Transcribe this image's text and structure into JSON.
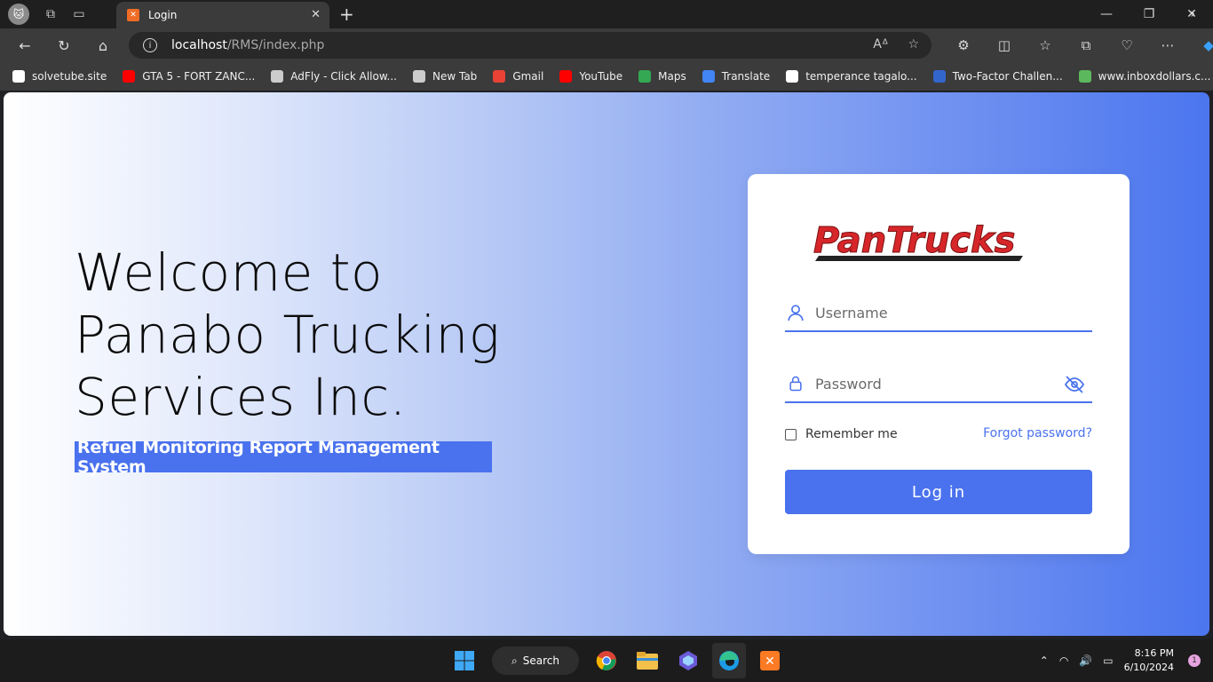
{
  "browser": {
    "tab_title": "Login",
    "url_host": "localhost",
    "url_path": "/RMS/index.php",
    "bookmarks": [
      {
        "label": "solvetube.site",
        "icon": "page-icon",
        "color": "#ffffff"
      },
      {
        "label": "GTA 5 - FORT ZANC...",
        "icon": "youtube-icon",
        "color": "#ff0000"
      },
      {
        "label": "AdFly - Click Allow...",
        "icon": "page-icon",
        "color": "#cccccc"
      },
      {
        "label": "New Tab",
        "icon": "page-icon",
        "color": "#cccccc"
      },
      {
        "label": "Gmail",
        "icon": "gmail-icon",
        "color": "#ea4335"
      },
      {
        "label": "YouTube",
        "icon": "youtube-icon",
        "color": "#ff0000"
      },
      {
        "label": "Maps",
        "icon": "maps-icon",
        "color": "#34a853"
      },
      {
        "label": "Translate",
        "icon": "translate-icon",
        "color": "#4285f4"
      },
      {
        "label": "temperance tagalo...",
        "icon": "google-icon",
        "color": "#ffffff"
      },
      {
        "label": "Two-Factor Challen...",
        "icon": "fp-icon",
        "color": "#3366cc"
      },
      {
        "label": "www.inboxdollars.c...",
        "icon": "inboxdollars-icon",
        "color": "#5cb85c"
      }
    ]
  },
  "page": {
    "welcome_line1": "Welcome to",
    "welcome_line2": "Panabo Trucking",
    "welcome_line3": "Services Inc.",
    "subtitle": "Refuel Monitoring Report Management System",
    "logo_text": "PanTrucks",
    "username_placeholder": "Username",
    "password_placeholder": "Password",
    "remember_label": "Remember me",
    "forgot_label": "Forgot password?",
    "login_label": "Log in",
    "accent_color": "#4a72ee"
  },
  "taskbar": {
    "search_label": "Search",
    "time": "8:16 PM",
    "date": "6/10/2024",
    "notification_count": "1"
  }
}
